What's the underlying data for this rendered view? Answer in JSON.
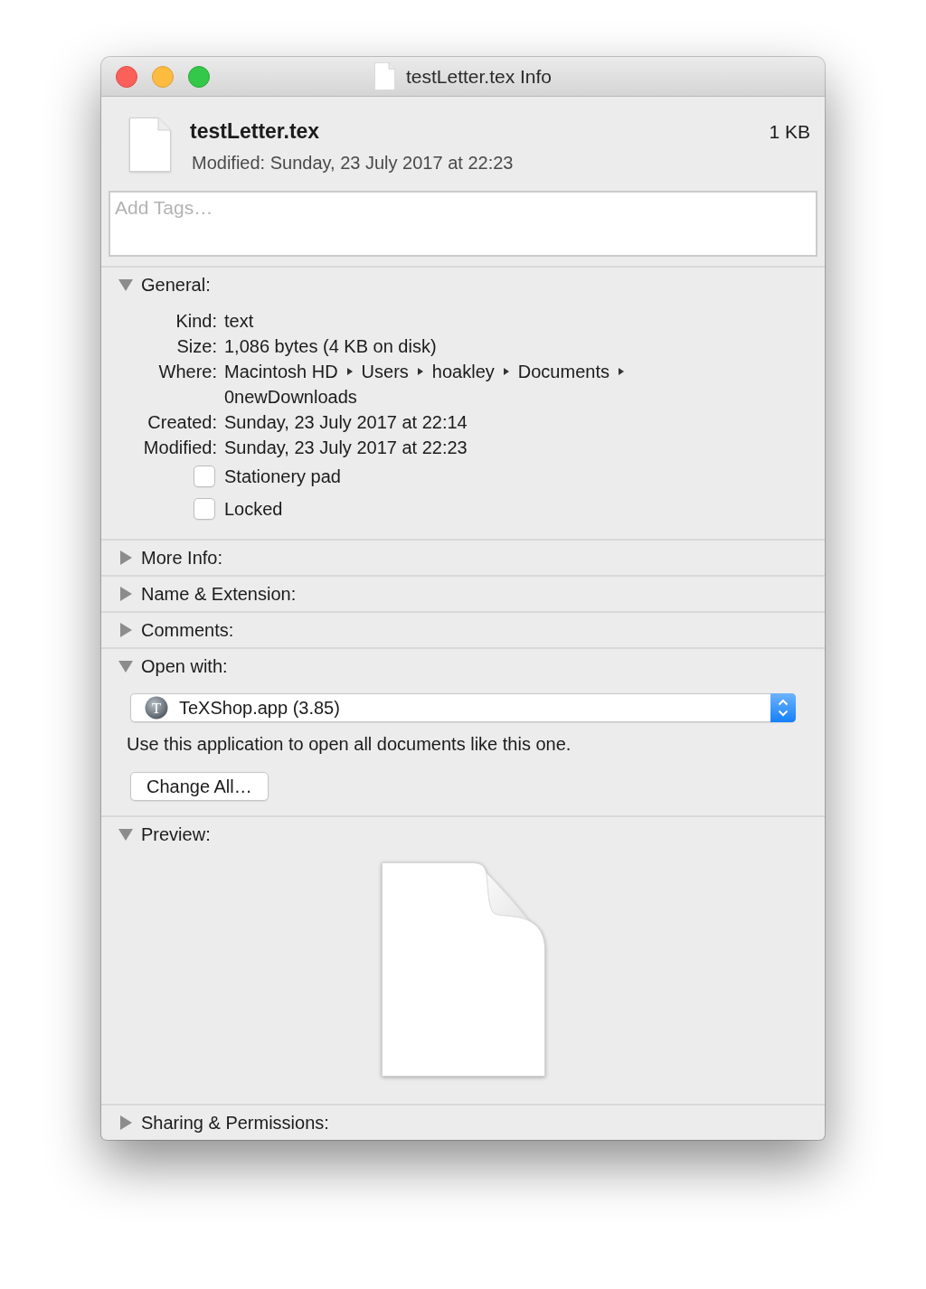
{
  "window": {
    "title": "testLetter.tex Info"
  },
  "header": {
    "name": "testLetter.tex",
    "size": "1 KB",
    "modified": "Modified: Sunday, 23 July 2017 at 22:23"
  },
  "tags": {
    "placeholder": "Add Tags…"
  },
  "sections": [
    {
      "title": "General:",
      "expanded": true,
      "content": {
        "kind": "details",
        "fields": [
          {
            "kind": "text",
            "label": "Kind:",
            "value": "text"
          },
          {
            "kind": "text",
            "label": "Size:",
            "value": "1,086 bytes (4 KB on disk)"
          },
          {
            "kind": "path",
            "label": "Where:",
            "path": [
              "Macintosh HD",
              "Users",
              "hoakley",
              "Documents",
              "0newDownloads"
            ]
          },
          {
            "kind": "text",
            "label": "Created:",
            "value": "Sunday, 23 July 2017 at 22:14"
          },
          {
            "kind": "text",
            "label": "Modified:",
            "value": "Sunday, 23 July 2017 at 22:23"
          }
        ],
        "checkboxes": [
          {
            "label": "Stationery pad",
            "checked": false
          },
          {
            "label": "Locked",
            "checked": false
          }
        ]
      }
    },
    {
      "title": "More Info:",
      "expanded": false
    },
    {
      "title": "Name & Extension:",
      "expanded": false
    },
    {
      "title": "Comments:",
      "expanded": false
    },
    {
      "title": "Open with:",
      "expanded": true,
      "content": {
        "kind": "open_with",
        "app": {
          "name": "TeXShop.app (3.85)",
          "icon_letter": "T"
        },
        "note": "Use this application to open all documents like this one.",
        "button": "Change All…"
      }
    },
    {
      "title": "Preview:",
      "expanded": true,
      "content": {
        "kind": "preview"
      }
    },
    {
      "title": "Sharing & Permissions:",
      "expanded": false
    }
  ]
}
